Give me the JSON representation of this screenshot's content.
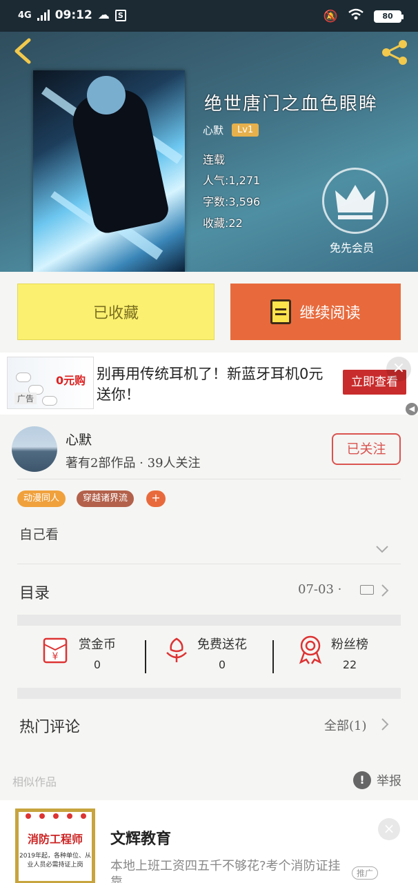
{
  "status_bar": {
    "network": "4G",
    "time": "09:12",
    "battery": "80"
  },
  "book": {
    "title": "绝世唐门之血色眼眸",
    "author": "心默",
    "level": "Lv1",
    "status": "连载",
    "popularity": "人气:1,271",
    "word_count": "字数:3,596",
    "favorites": "收藏:22",
    "vip_label": "免先会员"
  },
  "actions": {
    "collected_label": "已收藏",
    "continue_label": "继续阅读"
  },
  "ad": {
    "promo_text": "0元购",
    "text": "别再用传统耳机了！新蓝牙耳机0元送你！",
    "cta": "立即查看",
    "tag": "广告",
    "close": "×"
  },
  "author_card": {
    "name": "心默",
    "subtitle": "著有2部作品 · 39人关注",
    "follow_label": "已关注"
  },
  "tags": [
    {
      "label": "动漫同人",
      "color": "#f0a13c"
    },
    {
      "label": "穿越诸界流",
      "color": "#b3614b"
    }
  ],
  "tag_add": "+",
  "description": "自己看",
  "toc": {
    "label": "目录",
    "date": "07-03 · "
  },
  "stats": [
    {
      "label": "赏金币",
      "value": "0",
      "icon": "red-envelope-icon"
    },
    {
      "label": "免费送花",
      "value": "0",
      "icon": "flower-icon"
    },
    {
      "label": "粉丝榜",
      "value": "22",
      "icon": "medal-icon"
    }
  ],
  "comments": {
    "label": "热门评论",
    "all": "全部(1)"
  },
  "similar": {
    "label": "相似作品",
    "report": "举报"
  },
  "ad2": {
    "cert_title": "消防工程师",
    "cert_body": "2019年起，各种单位、从业人员必需持证上岗",
    "title": "文辉教育",
    "desc": "本地上班工资四五千不够花?考个消防证挂靠…",
    "tag": "推广",
    "close": "×"
  },
  "colors": {
    "accent": "#e86a3c",
    "collect_bg": "#fbf06f",
    "follow_red": "#d9534f"
  }
}
